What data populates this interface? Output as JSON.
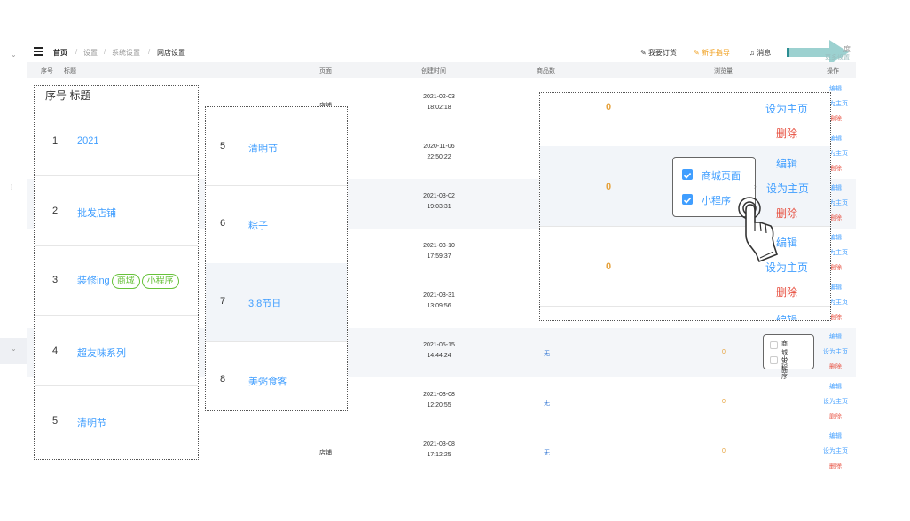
{
  "breadcrumb": {
    "home": "首页",
    "sep": "/",
    "items": [
      "设置",
      "系统设置",
      "网店设置"
    ]
  },
  "header": {
    "order_label": "我要订货",
    "guide_label": "新手指导",
    "message_label": "消息",
    "top_right_text": "度",
    "sub_text": "更多设置"
  },
  "columns": {
    "index": "序号",
    "title": "标题",
    "page": "页面",
    "created": "创建时间",
    "products": "商品数",
    "views": "浏览量",
    "actions": "操作"
  },
  "background_rows": [
    {
      "page": "店铺",
      "date": "2021-02-03",
      "time": "18:02:18"
    },
    {
      "page": "",
      "date": "2020-11-06",
      "time": "22:50:22"
    },
    {
      "page": "",
      "date": "2021-03-02",
      "time": "19:03:31"
    },
    {
      "page": "",
      "date": "2021-03-10",
      "time": "17:59:37"
    },
    {
      "page": "",
      "date": "2021-03-31",
      "time": "13:09:56"
    },
    {
      "page": "",
      "date": "2021-05-15",
      "time": "14:44:24",
      "products": "无",
      "views": "0"
    },
    {
      "page": "",
      "date": "2021-03-08",
      "time": "12:20:55",
      "products": "无",
      "views": "0"
    },
    {
      "page": "店铺",
      "date": "2021-03-08",
      "time": "17:12:25",
      "products": "无",
      "views": "0"
    }
  ],
  "row_actions": {
    "edit": "编辑",
    "set_home": "设为主页",
    "delete": "删除"
  },
  "zoom_left": {
    "header": "序号  标题",
    "rows": [
      {
        "num": "1",
        "title": "2021"
      },
      {
        "num": "2",
        "title": "批发店铺"
      },
      {
        "num": "3",
        "title": "装修ing",
        "tags": [
          "商城",
          "小程序"
        ]
      },
      {
        "num": "4",
        "title": "超友味系列"
      },
      {
        "num": "5",
        "title": "清明节"
      }
    ]
  },
  "zoom_mid": {
    "rows": [
      {
        "num": "5",
        "title": "清明节"
      },
      {
        "num": "6",
        "title": "粽子"
      },
      {
        "num": "7",
        "title": "3.8节日"
      },
      {
        "num": "8",
        "title": "美粥食客"
      }
    ]
  },
  "zoom_right": {
    "zeros": [
      "0",
      "0",
      "0"
    ],
    "checkbox_popup": {
      "options": [
        "商城页面",
        "小程序"
      ]
    }
  },
  "small_popup": {
    "options": [
      "商城页面",
      "小程序"
    ]
  },
  "colors": {
    "link": "#409eff",
    "danger": "#e74c3c",
    "warning": "#e6a23c",
    "tag": "#67c23a",
    "arrow": "#9cd1d0"
  }
}
